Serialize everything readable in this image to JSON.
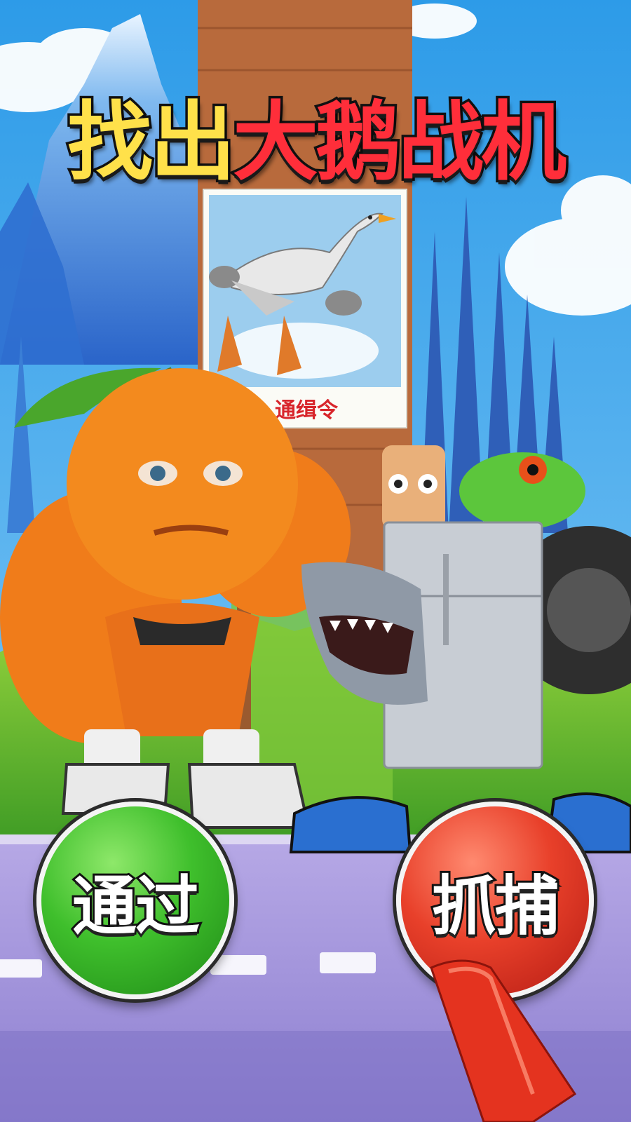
{
  "title": {
    "part1": "找出",
    "part2": "大鹅战机"
  },
  "wanted_poster": {
    "label": "通缉令",
    "subject": "goose-airplane"
  },
  "characters": [
    "muscle-orange",
    "shark-fridge-frog-tire-creature"
  ],
  "buttons": {
    "pass_label": "通过",
    "catch_label": "抓捕"
  },
  "colors": {
    "pass": "#3fbf2c",
    "catch": "#e8402a",
    "title_yellow": "#ffe14a",
    "title_red": "#ff2e3a"
  }
}
